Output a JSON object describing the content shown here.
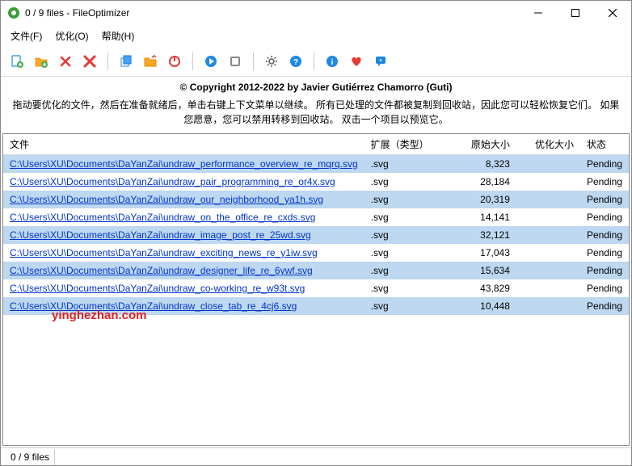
{
  "window": {
    "title": "0 / 9 files - FileOptimizer"
  },
  "menu": {
    "file": "文件(F)",
    "optimize": "优化(O)",
    "help": "帮助(H)"
  },
  "info": {
    "copyright": "© Copyright 2012-2022 by Javier Gutiérrez Chamorro (Guti)",
    "instructions": "拖动要优化的文件，然后在准备就绪后，单击右键上下文菜单以继续。 所有已处理的文件都被复制到回收站，因此您可以轻松恢复它们。 如果您愿意，您可以禁用转移到回收站。 双击一个项目以预览它。"
  },
  "columns": {
    "file": "文件",
    "ext": "扩展（类型）",
    "orig": "原始大小",
    "opt": "优化大小",
    "status": "状态"
  },
  "rows": [
    {
      "file": "C:\\Users\\XU\\Documents\\DaYanZai\\undraw_performance_overview_re_mqrq.svg",
      "ext": ".svg",
      "orig": "8,323",
      "opt": "",
      "status": "Pending"
    },
    {
      "file": "C:\\Users\\XU\\Documents\\DaYanZai\\undraw_pair_programming_re_or4x.svg",
      "ext": ".svg",
      "orig": "28,184",
      "opt": "",
      "status": "Pending"
    },
    {
      "file": "C:\\Users\\XU\\Documents\\DaYanZai\\undraw_our_neighborhood_ya1h.svg",
      "ext": ".svg",
      "orig": "20,319",
      "opt": "",
      "status": "Pending"
    },
    {
      "file": "C:\\Users\\XU\\Documents\\DaYanZai\\undraw_on_the_office_re_cxds.svg",
      "ext": ".svg",
      "orig": "14,141",
      "opt": "",
      "status": "Pending"
    },
    {
      "file": "C:\\Users\\XU\\Documents\\DaYanZai\\undraw_image_post_re_25wd.svg",
      "ext": ".svg",
      "orig": "32,121",
      "opt": "",
      "status": "Pending"
    },
    {
      "file": "C:\\Users\\XU\\Documents\\DaYanZai\\undraw_exciting_news_re_y1iw.svg",
      "ext": ".svg",
      "orig": "17,043",
      "opt": "",
      "status": "Pending"
    },
    {
      "file": "C:\\Users\\XU\\Documents\\DaYanZai\\undraw_designer_life_re_6ywf.svg",
      "ext": ".svg",
      "orig": "15,634",
      "opt": "",
      "status": "Pending"
    },
    {
      "file": "C:\\Users\\XU\\Documents\\DaYanZai\\undraw_co-working_re_w93t.svg",
      "ext": ".svg",
      "orig": "43,829",
      "opt": "",
      "status": "Pending"
    },
    {
      "file": "C:\\Users\\XU\\Documents\\DaYanZai\\undraw_close_tab_re_4cj6.svg",
      "ext": ".svg",
      "orig": "10,448",
      "opt": "",
      "status": "Pending"
    }
  ],
  "status": {
    "text": "0 / 9 files"
  },
  "watermark": "yinghezhan.com"
}
